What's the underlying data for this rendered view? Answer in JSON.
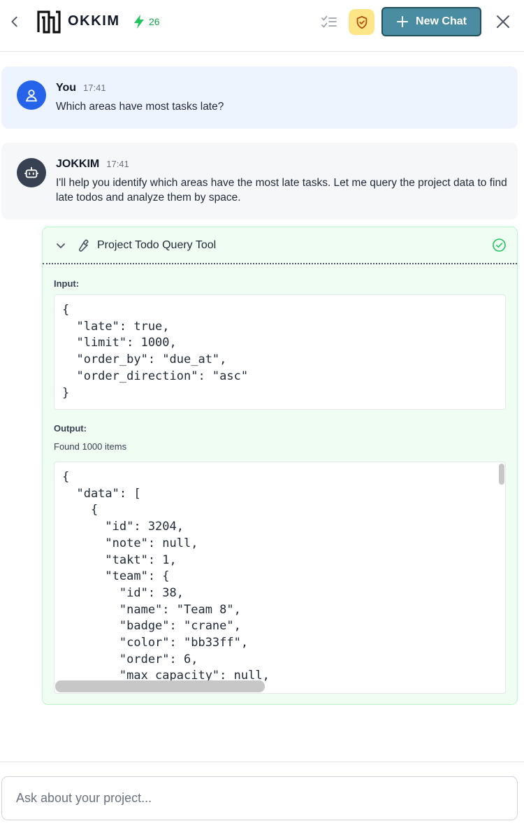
{
  "header": {
    "brand": "OKKIM",
    "credits": "26",
    "new_chat_label": "New Chat"
  },
  "messages": [
    {
      "author": "You",
      "time": "17:41",
      "text": "Which areas have most tasks late?"
    },
    {
      "author": "JOKKIM",
      "time": "17:41",
      "text": "I'll help you identify which areas have the most late tasks. Let me query the project data to find late todos and analyze them by space."
    }
  ],
  "tool": {
    "title": "Project Todo Query Tool",
    "input_label": "Input:",
    "input_code": "{\n  \"late\": true,\n  \"limit\": 1000,\n  \"order_by\": \"due_at\",\n  \"order_direction\": \"asc\"\n}",
    "output_label": "Output:",
    "found_text": "Found 1000 items",
    "output_code": "{\n  \"data\": [\n    {\n      \"id\": 3204,\n      \"note\": null,\n      \"takt\": 1,\n      \"team\": {\n        \"id\": 38,\n        \"name\": \"Team 8\",\n        \"badge\": \"crane\",\n        \"color\": \"bb33ff\",\n        \"order\": 6,\n        \"max_capacity\": null,"
  },
  "composer": {
    "placeholder": "Ask about your project..."
  },
  "colors": {
    "accent": "#4a8ca1",
    "user_avatar": "#2563eb",
    "bot_avatar": "#374151",
    "success": "#22c55e",
    "credits": "#16a34a",
    "shield_bg": "#fde68a"
  }
}
